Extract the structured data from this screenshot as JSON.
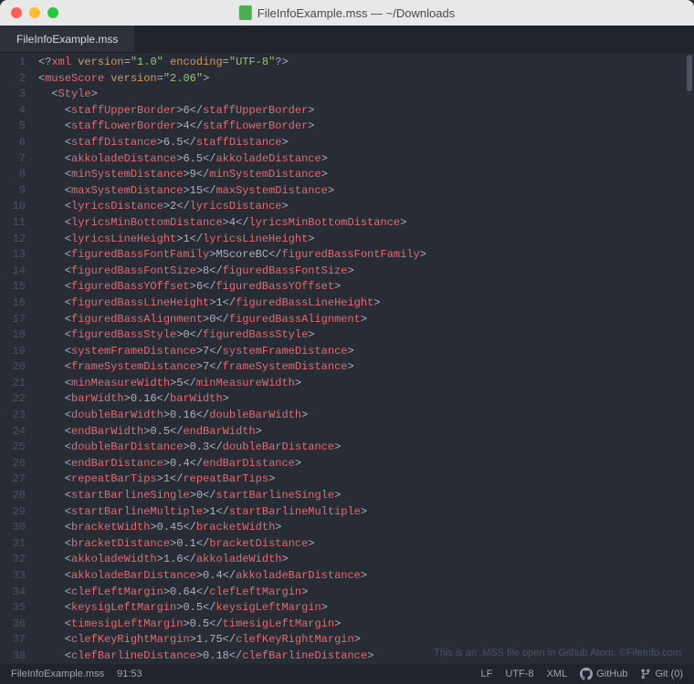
{
  "window": {
    "title": "FileInfoExample.mss — ~/Downloads"
  },
  "tab": {
    "label": "FileInfoExample.mss"
  },
  "code": {
    "lines": [
      {
        "indent": 0,
        "type": "xmldecl",
        "raw": "<?xml version=\"1.0\" encoding=\"UTF-8\"?>"
      },
      {
        "indent": 0,
        "type": "open",
        "name": "museScore",
        "attr": "version",
        "attrval": "\"2.06\""
      },
      {
        "indent": 1,
        "type": "open",
        "name": "Style"
      },
      {
        "indent": 2,
        "type": "pair",
        "name": "staffUpperBorder",
        "val": "6"
      },
      {
        "indent": 2,
        "type": "pair",
        "name": "staffLowerBorder",
        "val": "4"
      },
      {
        "indent": 2,
        "type": "pair",
        "name": "staffDistance",
        "val": "6.5"
      },
      {
        "indent": 2,
        "type": "pair",
        "name": "akkoladeDistance",
        "val": "6.5"
      },
      {
        "indent": 2,
        "type": "pair",
        "name": "minSystemDistance",
        "val": "9"
      },
      {
        "indent": 2,
        "type": "pair",
        "name": "maxSystemDistance",
        "val": "15"
      },
      {
        "indent": 2,
        "type": "pair",
        "name": "lyricsDistance",
        "val": "2"
      },
      {
        "indent": 2,
        "type": "pair",
        "name": "lyricsMinBottomDistance",
        "val": "4"
      },
      {
        "indent": 2,
        "type": "pair",
        "name": "lyricsLineHeight",
        "val": "1"
      },
      {
        "indent": 2,
        "type": "pair",
        "name": "figuredBassFontFamily",
        "val": "MScoreBC"
      },
      {
        "indent": 2,
        "type": "pair",
        "name": "figuredBassFontSize",
        "val": "8"
      },
      {
        "indent": 2,
        "type": "pair",
        "name": "figuredBassYOffset",
        "val": "6"
      },
      {
        "indent": 2,
        "type": "pair",
        "name": "figuredBassLineHeight",
        "val": "1"
      },
      {
        "indent": 2,
        "type": "pair",
        "name": "figuredBassAlignment",
        "val": "0"
      },
      {
        "indent": 2,
        "type": "pair",
        "name": "figuredBassStyle",
        "val": "0"
      },
      {
        "indent": 2,
        "type": "pair",
        "name": "systemFrameDistance",
        "val": "7"
      },
      {
        "indent": 2,
        "type": "pair",
        "name": "frameSystemDistance",
        "val": "7"
      },
      {
        "indent": 2,
        "type": "pair",
        "name": "minMeasureWidth",
        "val": "5"
      },
      {
        "indent": 2,
        "type": "pair",
        "name": "barWidth",
        "val": "0.16"
      },
      {
        "indent": 2,
        "type": "pair",
        "name": "doubleBarWidth",
        "val": "0.16"
      },
      {
        "indent": 2,
        "type": "pair",
        "name": "endBarWidth",
        "val": "0.5"
      },
      {
        "indent": 2,
        "type": "pair",
        "name": "doubleBarDistance",
        "val": "0.3"
      },
      {
        "indent": 2,
        "type": "pair",
        "name": "endBarDistance",
        "val": "0.4"
      },
      {
        "indent": 2,
        "type": "pair",
        "name": "repeatBarTips",
        "val": "1"
      },
      {
        "indent": 2,
        "type": "pair",
        "name": "startBarlineSingle",
        "val": "0"
      },
      {
        "indent": 2,
        "type": "pair",
        "name": "startBarlineMultiple",
        "val": "1"
      },
      {
        "indent": 2,
        "type": "pair",
        "name": "bracketWidth",
        "val": "0.45"
      },
      {
        "indent": 2,
        "type": "pair",
        "name": "bracketDistance",
        "val": "0.1"
      },
      {
        "indent": 2,
        "type": "pair",
        "name": "akkoladeWidth",
        "val": "1.6"
      },
      {
        "indent": 2,
        "type": "pair",
        "name": "akkoladeBarDistance",
        "val": "0.4"
      },
      {
        "indent": 2,
        "type": "pair",
        "name": "clefLeftMargin",
        "val": "0.64"
      },
      {
        "indent": 2,
        "type": "pair",
        "name": "keysigLeftMargin",
        "val": "0.5"
      },
      {
        "indent": 2,
        "type": "pair",
        "name": "timesigLeftMargin",
        "val": "0.5"
      },
      {
        "indent": 2,
        "type": "pair",
        "name": "clefKeyRightMargin",
        "val": "1.75"
      },
      {
        "indent": 2,
        "type": "pair",
        "name": "clefBarlineDistance",
        "val": "0.18"
      }
    ]
  },
  "watermark": "This is an .MSS file open in Github Atom. ©FileInfo.com",
  "status": {
    "filename": "FileInfoExample.mss",
    "cursor": "91:53",
    "line_ending": "LF",
    "encoding": "UTF-8",
    "language": "XML",
    "github": "GitHub",
    "git": "Git (0)"
  }
}
